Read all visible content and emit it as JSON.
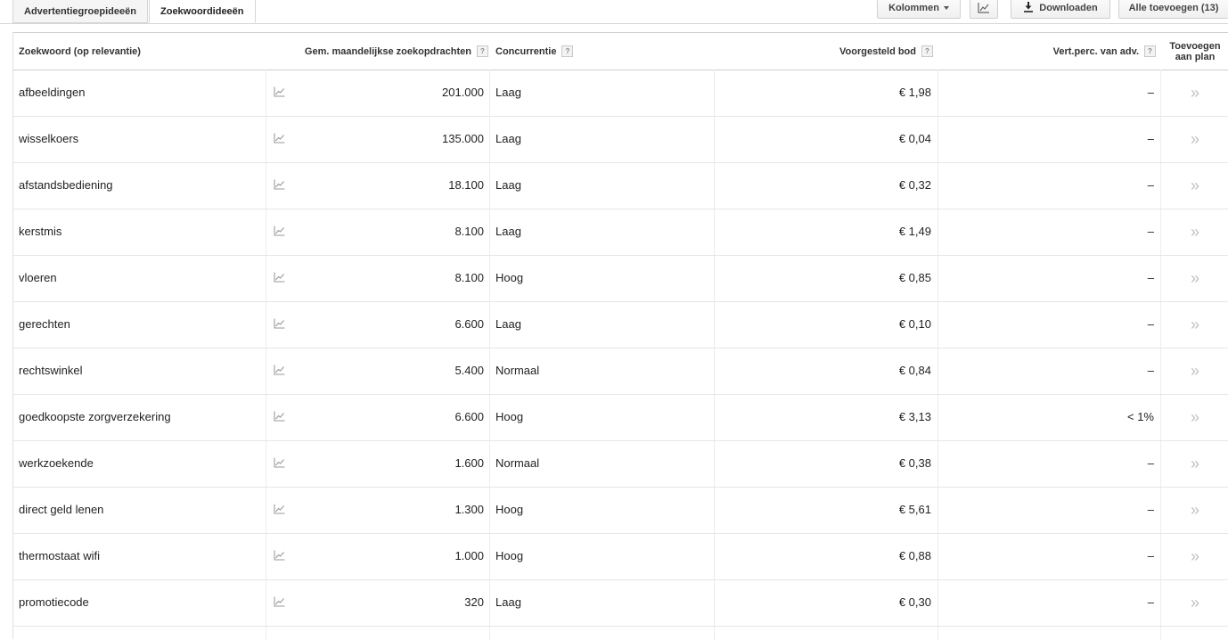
{
  "tabs": [
    {
      "label": "Advertentiegroepideeën",
      "active": false
    },
    {
      "label": "Zoekwoordideeën",
      "active": true
    }
  ],
  "toolbar": {
    "columns_label": "Kolommen",
    "download_label": "Downloaden",
    "add_all_label": "Alle toevoegen (13)"
  },
  "table": {
    "headers": {
      "keyword": "Zoekwoord (op relevantie)",
      "searches": "Gem. maandelijkse zoekopdrachten",
      "competition": "Concurrentie",
      "bid": "Voorgesteld bod",
      "share": "Vert.perc. van adv.",
      "add_line1": "Toevoegen",
      "add_line2": "aan plan"
    },
    "help_glyph": "?",
    "add_glyph": "»",
    "rows": [
      {
        "keyword": "afbeeldingen",
        "searches": "201.000",
        "competition": "Laag",
        "bid": "€ 1,98",
        "share": "–"
      },
      {
        "keyword": "wisselkoers",
        "searches": "135.000",
        "competition": "Laag",
        "bid": "€ 0,04",
        "share": "–"
      },
      {
        "keyword": "afstandsbediening",
        "searches": "18.100",
        "competition": "Laag",
        "bid": "€ 0,32",
        "share": "–"
      },
      {
        "keyword": "kerstmis",
        "searches": "8.100",
        "competition": "Laag",
        "bid": "€ 1,49",
        "share": "–"
      },
      {
        "keyword": "vloeren",
        "searches": "8.100",
        "competition": "Hoog",
        "bid": "€ 0,85",
        "share": "–"
      },
      {
        "keyword": "gerechten",
        "searches": "6.600",
        "competition": "Laag",
        "bid": "€ 0,10",
        "share": "–"
      },
      {
        "keyword": "rechtswinkel",
        "searches": "5.400",
        "competition": "Normaal",
        "bid": "€ 0,84",
        "share": "–"
      },
      {
        "keyword": "goedkoopste zorgverzekering",
        "searches": "6.600",
        "competition": "Hoog",
        "bid": "€ 3,13",
        "share": "< 1%"
      },
      {
        "keyword": "werkzoekende",
        "searches": "1.600",
        "competition": "Normaal",
        "bid": "€ 0,38",
        "share": "–"
      },
      {
        "keyword": "direct geld lenen",
        "searches": "1.300",
        "competition": "Hoog",
        "bid": "€ 5,61",
        "share": "–"
      },
      {
        "keyword": "thermostaat wifi",
        "searches": "1.000",
        "competition": "Hoog",
        "bid": "€ 0,88",
        "share": "–"
      },
      {
        "keyword": "promotiecode",
        "searches": "320",
        "competition": "Laag",
        "bid": "€ 0,30",
        "share": "–"
      }
    ]
  }
}
